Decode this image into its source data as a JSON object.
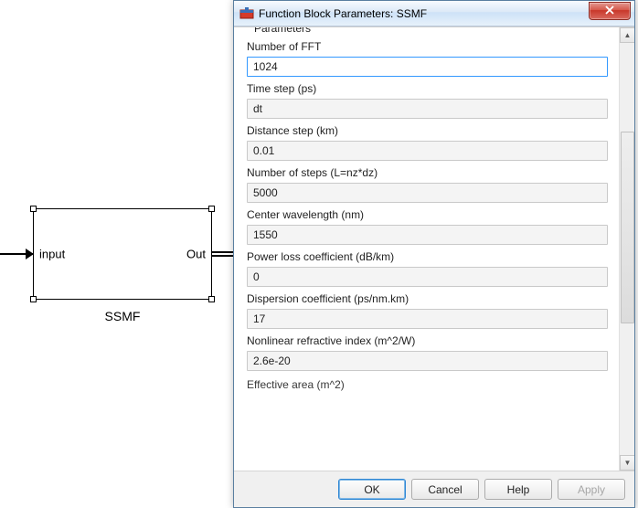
{
  "simulink": {
    "block_name": "SSMF",
    "input_label": "input",
    "output_label": "Out"
  },
  "dialog": {
    "title": "Function Block Parameters: SSMF",
    "close_label": "x",
    "group_label": "Parameters",
    "params": [
      {
        "label": "Number of FFT",
        "value": "1024"
      },
      {
        "label": "Time step (ps)",
        "value": "dt"
      },
      {
        "label": "Distance step (km)",
        "value": "0.01"
      },
      {
        "label": "Number of steps (L=nz*dz)",
        "value": "5000"
      },
      {
        "label": "Center wavelength (nm)",
        "value": "1550"
      },
      {
        "label": "Power loss coefficient (dB/km)",
        "value": "0"
      },
      {
        "label": "Dispersion coefficient (ps/nm.km)",
        "value": "17"
      },
      {
        "label": "Nonlinear refractive index (m^2/W)",
        "value": "2.6e-20"
      }
    ],
    "next_param_label": "Effective area (m^2)",
    "buttons": {
      "ok": "OK",
      "cancel": "Cancel",
      "help": "Help",
      "apply": "Apply"
    }
  }
}
